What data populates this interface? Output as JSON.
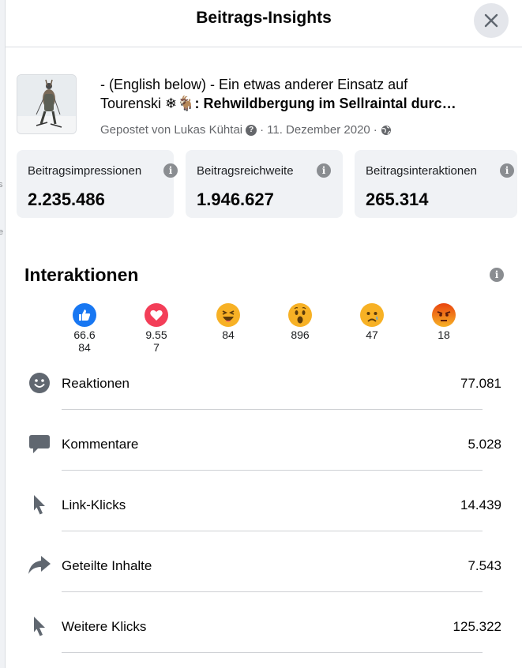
{
  "dialog": {
    "title": "Beitrags-Insights"
  },
  "post": {
    "text_line1": "- (English below) - Ein etwas anderer Einsatz auf",
    "text_line2_plain": "Tourenski ❄🐐",
    "text_line2_bold": ": Rehwildbergung im Sellraintal durc…",
    "author_text": "Gepostet von Lukas Kühtai",
    "date": "11. Dezember 2020"
  },
  "stats": [
    {
      "label": "Beitragsimpressionen",
      "value": "2.235.486"
    },
    {
      "label": "Beitragsreichweite",
      "value": "1.946.627"
    },
    {
      "label": "Beitragsinteraktionen",
      "value": "265.314"
    }
  ],
  "interactions": {
    "title": "Interaktionen",
    "reactions": [
      {
        "name": "like",
        "count": "66.684",
        "color": "#1877f2"
      },
      {
        "name": "love",
        "count": "9.557",
        "color": "#f33e58"
      },
      {
        "name": "haha",
        "count": "84",
        "color": "#f7b125"
      },
      {
        "name": "wow",
        "count": "896",
        "color": "#f7b125"
      },
      {
        "name": "sad",
        "count": "47",
        "color": "#f7b125"
      },
      {
        "name": "angry",
        "count": "18",
        "color": "#e9710f"
      }
    ],
    "metrics": [
      {
        "icon": "smiley-icon",
        "label": "Reaktionen",
        "value": "77.081"
      },
      {
        "icon": "comment-icon",
        "label": "Kommentare",
        "value": "5.028"
      },
      {
        "icon": "cursor-icon",
        "label": "Link-Klicks",
        "value": "14.439"
      },
      {
        "icon": "share-icon",
        "label": "Geteilte Inhalte",
        "value": "7.543"
      },
      {
        "icon": "cursor-icon",
        "label": "Weitere Klicks",
        "value": "125.322"
      }
    ]
  },
  "left_edge_glyphs": [
    "s",
    "e",
    "i"
  ]
}
